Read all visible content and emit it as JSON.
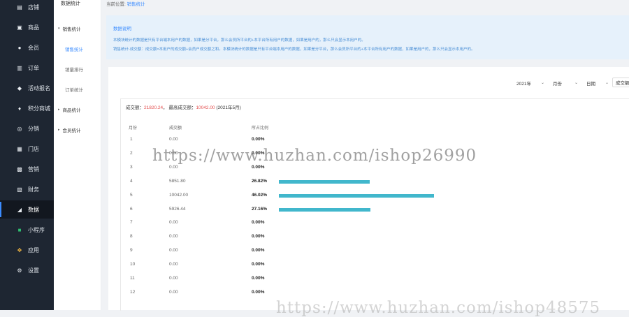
{
  "sidebar": {
    "items": [
      {
        "icon": "store-icon",
        "label": "店铺"
      },
      {
        "icon": "goods-icon",
        "label": "商品"
      },
      {
        "icon": "user-icon",
        "label": "会员"
      },
      {
        "icon": "order-icon",
        "label": "订单"
      },
      {
        "icon": "tag-icon",
        "label": "活动报名"
      },
      {
        "icon": "points-icon",
        "label": "积分商城"
      },
      {
        "icon": "distribution-icon",
        "label": "分销"
      },
      {
        "icon": "shop-icon",
        "label": "门店"
      },
      {
        "icon": "marketing-icon",
        "label": "营销"
      },
      {
        "icon": "finance-icon",
        "label": "财务"
      },
      {
        "icon": "data-icon",
        "label": "数据"
      },
      {
        "icon": "mini-program-icon",
        "label": "小程序"
      },
      {
        "icon": "apps-icon",
        "label": "应用"
      },
      {
        "icon": "settings-icon",
        "label": "设置"
      }
    ],
    "active_index": 10
  },
  "subnav": {
    "title": "数据统计",
    "groups": [
      {
        "label": "销售统计",
        "items": [
          {
            "label": "销售统计",
            "active": true
          },
          {
            "label": "销量排行"
          },
          {
            "label": "订单统计"
          }
        ]
      },
      {
        "label": "商品统计",
        "items": []
      },
      {
        "label": "会员统计",
        "items": []
      }
    ]
  },
  "breadcrumb": {
    "prefix": "当前位置:",
    "current": "销售统计"
  },
  "notice": {
    "title": "数据说明",
    "lines": [
      "本模块统计的数据是只有平台端本用户的数据，如果是分平台，那么会员所平台的+本平台所有用户的数据，如果是用户的，那么只会显示本用户的。",
      "销售统计-成交额：成交额=本用户的成交额+会员户成交额之和。本模块统计的数据是只有平台端本用户的数据，如果是分平台，那么会员所平台的+本平台所有用户的数据，如果是用户的，那么只会显示本用户的。"
    ]
  },
  "filters": {
    "year": "2021年",
    "unit": "月份",
    "type": "日期",
    "extra": "成交额"
  },
  "summary": {
    "label1": "成交额：",
    "value1": "21820.24",
    "sep": "，",
    "label2": "最高成交额：",
    "value2": "10042.00",
    "period": "(2021年5月)"
  },
  "table": {
    "headers": [
      "月份",
      "成交额",
      "所占比例"
    ],
    "rows": [
      {
        "month": "1",
        "amount": "0.00",
        "pct": "0.00%",
        "ratio": 0
      },
      {
        "month": "2",
        "amount": "0.00",
        "pct": "0.00%",
        "ratio": 0
      },
      {
        "month": "3",
        "amount": "0.00",
        "pct": "0.00%",
        "ratio": 0
      },
      {
        "month": "4",
        "amount": "5851.80",
        "pct": "26.82%",
        "ratio": 0.2682
      },
      {
        "month": "5",
        "amount": "10042.00",
        "pct": "46.02%",
        "ratio": 0.4602
      },
      {
        "month": "6",
        "amount": "5926.44",
        "pct": "27.16%",
        "ratio": 0.2716
      },
      {
        "month": "7",
        "amount": "0.00",
        "pct": "0.00%",
        "ratio": 0
      },
      {
        "month": "8",
        "amount": "0.00",
        "pct": "0.00%",
        "ratio": 0
      },
      {
        "month": "9",
        "amount": "0.00",
        "pct": "0.00%",
        "ratio": 0
      },
      {
        "month": "10",
        "amount": "0.00",
        "pct": "0.00%",
        "ratio": 0
      },
      {
        "month": "11",
        "amount": "0.00",
        "pct": "0.00%",
        "ratio": 0
      },
      {
        "month": "12",
        "amount": "0.00",
        "pct": "0.00%",
        "ratio": 0
      }
    ],
    "bar_color": "#41b7cc"
  },
  "watermark": "https://www.huzhan.com/ishop26990",
  "watermark2": "https://www.huzhan.com/ishop48575"
}
